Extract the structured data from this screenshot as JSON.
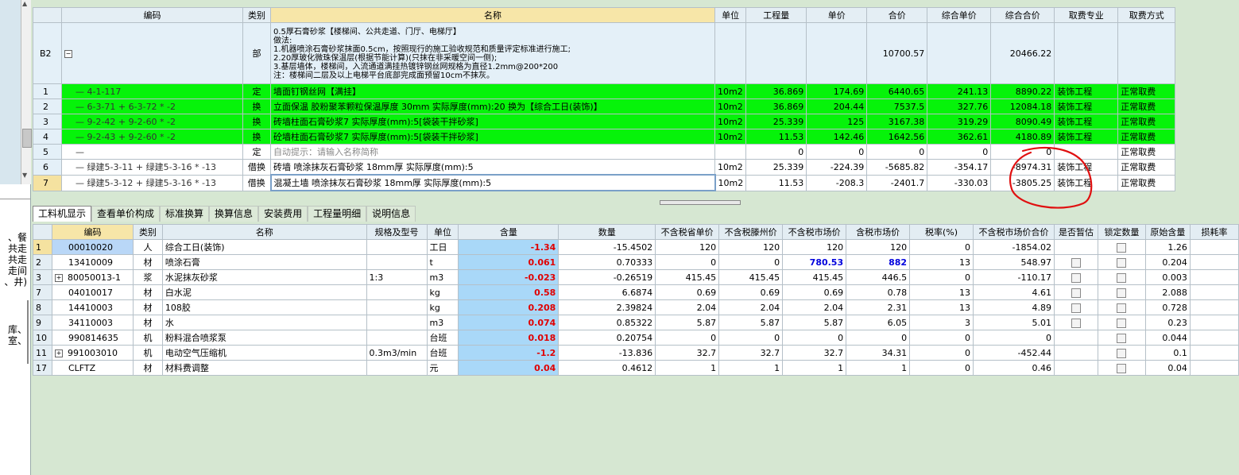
{
  "left_panel": {
    "text_lines": [
      "、餐",
      "共走",
      "共走",
      "走间",
      "、井)"
    ],
    "text_lines2": [
      "库、",
      "室、"
    ]
  },
  "top_table": {
    "headers": [
      "编码",
      "类别",
      "名称",
      "单位",
      "工程量",
      "单价",
      "合价",
      "综合单价",
      "综合合价",
      "取费专业",
      "取费方式"
    ],
    "rows": [
      {
        "no": "B2",
        "code": "",
        "type": "部",
        "name": "0.5厚石膏砂浆【楼梯间、公共走道、门厅、电梯厅】\n做法:\n1.机器喷涂石膏砂浆抹面0.5cm，按照现行的施工验收规范和质量评定标准进行施工;\n2.20厚玻化微珠保温层(根据节能计算)(只抹在非采暖空间一侧);\n3.基层墙体，楼梯间，入流通道满挂热镀锌钢丝网规格为直径1.2mm@200*200\n注：楼梯间二层及以上电梯平台底部完成面预留10cm不抹灰。",
        "unit": "",
        "qty": "",
        "price": "",
        "total": "10700.57",
        "comp_price": "",
        "comp_total": "20466.22",
        "major": "",
        "method": ""
      },
      {
        "no": "1",
        "code": "4-1-117",
        "type": "定",
        "name": "墙面钉钢丝网【满挂】",
        "unit": "10m2",
        "qty": "36.869",
        "price": "174.69",
        "total": "6440.65",
        "comp_price": "241.13",
        "comp_total": "8890.22",
        "major": "装饰工程",
        "method": "正常取费"
      },
      {
        "no": "2",
        "code": "6-3-71 + 6-3-72 * -2",
        "type": "换",
        "name": "立面保温 胶粉聚苯颗粒保温厚度 30mm  实际厚度(mm):20 换为【综合工日(装饰)】",
        "unit": "10m2",
        "qty": "36.869",
        "price": "204.44",
        "total": "7537.5",
        "comp_price": "327.76",
        "comp_total": "12084.18",
        "major": "装饰工程",
        "method": "正常取费"
      },
      {
        "no": "3",
        "code": "9-2-42 + 9-2-60 * -2",
        "type": "换",
        "name": "砖墙柱面石膏砂浆7 实际厚度(mm):5[袋装干拌砂浆]",
        "unit": "10m2",
        "qty": "25.339",
        "price": "125",
        "total": "3167.38",
        "comp_price": "319.29",
        "comp_total": "8090.49",
        "major": "装饰工程",
        "method": "正常取费"
      },
      {
        "no": "4",
        "code": "9-2-43 + 9-2-60 * -2",
        "type": "换",
        "name": "砼墙柱面石膏砂浆7 实际厚度(mm):5[袋装干拌砂浆]",
        "unit": "10m2",
        "qty": "11.53",
        "price": "142.46",
        "total": "1642.56",
        "comp_price": "362.61",
        "comp_total": "4180.89",
        "major": "装饰工程",
        "method": "正常取费"
      },
      {
        "no": "5",
        "code": "",
        "type": "定",
        "name": "自动提示：请输入名称简称",
        "unit": "",
        "qty": "0",
        "price": "0",
        "total": "0",
        "comp_price": "0",
        "comp_total": "0",
        "major": "",
        "method": "正常取费"
      },
      {
        "no": "6",
        "code": "绿建5-3-11 + 绿建5-3-16 * -13",
        "type": "借换",
        "name": "砖墙 喷涂抹灰石膏砂浆 18mm厚 实际厚度(mm):5",
        "unit": "10m2",
        "qty": "25.339",
        "price": "-224.39",
        "total": "-5685.82",
        "comp_price": "-354.17",
        "comp_total": "-8974.31",
        "major": "装饰工程",
        "method": "正常取费"
      },
      {
        "no": "7",
        "code": "绿建5-3-12 + 绿建5-3-16 * -13",
        "type": "借换",
        "name": "混凝土墙 喷涂抹灰石膏砂浆 18mm厚 实际厚度(mm):5",
        "unit": "10m2",
        "qty": "11.53",
        "price": "-208.3",
        "total": "-2401.7",
        "comp_price": "-330.03",
        "comp_total": "-3805.25",
        "major": "装饰工程",
        "method": "正常取费"
      }
    ]
  },
  "tabs": [
    "工料机显示",
    "查看单价构成",
    "标准换算",
    "换算信息",
    "安装费用",
    "工程量明细",
    "说明信息"
  ],
  "bottom_table": {
    "headers": [
      "编码",
      "类别",
      "名称",
      "规格及型号",
      "单位",
      "含量",
      "数量",
      "不含税省单价",
      "不含税滕州价",
      "不含税市场价",
      "含税市场价",
      "税率(%)",
      "不含税市场价合价",
      "是否暂估",
      "锁定数量",
      "原始含量",
      "损耗率"
    ],
    "rows": [
      {
        "no": "1",
        "expand": false,
        "code": "00010020",
        "type": "人",
        "name": "综合工日(装饰)",
        "spec": "",
        "unit": "工日",
        "content": "-1.34",
        "qty": "-15.4502",
        "p1": "120",
        "p2": "120",
        "p3": "120",
        "p4": "120",
        "tax": "0",
        "sum": "-1854.02",
        "est": false,
        "lock": true,
        "orig": "1.26"
      },
      {
        "no": "2",
        "expand": false,
        "code": "13410009",
        "type": "材",
        "name": "喷涂石膏",
        "spec": "",
        "unit": "t",
        "content": "0.061",
        "qty": "0.70333",
        "p1": "0",
        "p2": "0",
        "p3": "780.53",
        "p4": "882",
        "tax": "13",
        "sum": "548.97",
        "est": true,
        "lock": true,
        "orig": "0.204"
      },
      {
        "no": "3",
        "expand": true,
        "code": "80050013-1",
        "type": "浆",
        "name": "水泥抹灰砂浆",
        "spec": "1:3",
        "unit": "m3",
        "content": "-0.023",
        "qty": "-0.26519",
        "p1": "415.45",
        "p2": "415.45",
        "p3": "415.45",
        "p4": "446.5",
        "tax": "0",
        "sum": "-110.17",
        "est": true,
        "lock": true,
        "orig": "0.003"
      },
      {
        "no": "7",
        "expand": false,
        "code": "04010017",
        "type": "材",
        "name": "白水泥",
        "spec": "",
        "unit": "kg",
        "content": "0.58",
        "qty": "6.6874",
        "p1": "0.69",
        "p2": "0.69",
        "p3": "0.69",
        "p4": "0.78",
        "tax": "13",
        "sum": "4.61",
        "est": true,
        "lock": true,
        "orig": "2.088"
      },
      {
        "no": "8",
        "expand": false,
        "code": "14410003",
        "type": "材",
        "name": "108胶",
        "spec": "",
        "unit": "kg",
        "content": "0.208",
        "qty": "2.39824",
        "p1": "2.04",
        "p2": "2.04",
        "p3": "2.04",
        "p4": "2.31",
        "tax": "13",
        "sum": "4.89",
        "est": true,
        "lock": true,
        "orig": "0.728"
      },
      {
        "no": "9",
        "expand": false,
        "code": "34110003",
        "type": "材",
        "name": "水",
        "spec": "",
        "unit": "m3",
        "content": "0.074",
        "qty": "0.85322",
        "p1": "5.87",
        "p2": "5.87",
        "p3": "5.87",
        "p4": "6.05",
        "tax": "3",
        "sum": "5.01",
        "est": true,
        "lock": true,
        "orig": "0.23"
      },
      {
        "no": "10",
        "expand": false,
        "code": "990814635",
        "type": "机",
        "name": "粉料混合喷浆泵",
        "spec": "",
        "unit": "台班",
        "content": "0.018",
        "qty": "0.20754",
        "p1": "0",
        "p2": "0",
        "p3": "0",
        "p4": "0",
        "tax": "0",
        "sum": "0",
        "est": false,
        "lock": true,
        "orig": "0.044"
      },
      {
        "no": "11",
        "expand": true,
        "code": "991003010",
        "type": "机",
        "name": "电动空气压缩机",
        "spec": "0.3m3/min",
        "unit": "台班",
        "content": "-1.2",
        "qty": "-13.836",
        "p1": "32.7",
        "p2": "32.7",
        "p3": "32.7",
        "p4": "34.31",
        "tax": "0",
        "sum": "-452.44",
        "est": false,
        "lock": true,
        "orig": "0.1"
      },
      {
        "no": "17",
        "expand": false,
        "code": "CLFTZ",
        "type": "材",
        "name": "材料费调整",
        "spec": "",
        "unit": "元",
        "content": "0.04",
        "qty": "0.4612",
        "p1": "1",
        "p2": "1",
        "p3": "1",
        "p4": "1",
        "tax": "0",
        "sum": "0.46",
        "est": false,
        "lock": true,
        "orig": "0.04"
      }
    ]
  },
  "colors": {
    "green_row": "#06f30a",
    "header_highlight": "#f7e6a8",
    "annotation_red": "#e01010",
    "content_blue": "#a9d8f8"
  }
}
